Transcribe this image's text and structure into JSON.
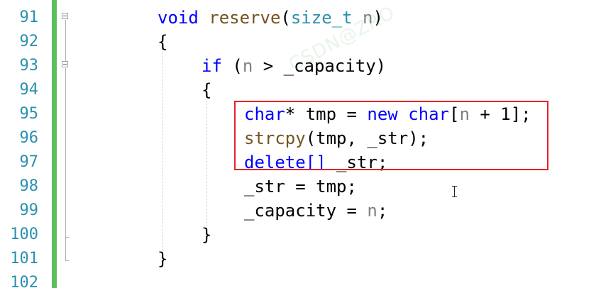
{
  "editor": {
    "lines": [
      {
        "num": "91",
        "tokens": [
          [
            "fn",
            "void "
          ],
          [
            "fn2",
            "reserve"
          ],
          [
            "pl",
            "("
          ],
          [
            "ty",
            "size_t"
          ],
          [
            "pl",
            " "
          ],
          [
            "pm",
            "n"
          ],
          [
            "pl",
            ")"
          ]
        ]
      },
      {
        "num": "92",
        "tokens": [
          [
            "pl",
            "{"
          ]
        ]
      },
      {
        "num": "93",
        "tokens": [
          [
            "kw",
            "if"
          ],
          [
            "pl",
            " ("
          ],
          [
            "pm",
            "n"
          ],
          [
            "pl",
            " > _capacity)"
          ]
        ]
      },
      {
        "num": "94",
        "tokens": [
          [
            "pl",
            "{"
          ]
        ]
      },
      {
        "num": "95",
        "tokens": [
          [
            "kw",
            "char"
          ],
          [
            "pl",
            "* tmp = "
          ],
          [
            "kw",
            "new"
          ],
          [
            "pl",
            " "
          ],
          [
            "kw",
            "char"
          ],
          [
            "pl",
            "["
          ],
          [
            "pm",
            "n"
          ],
          [
            "pl",
            " + 1];"
          ]
        ]
      },
      {
        "num": "96",
        "tokens": [
          [
            "fn2",
            "strcpy"
          ],
          [
            "pl",
            "(tmp, _str);"
          ]
        ]
      },
      {
        "num": "97",
        "tokens": [
          [
            "kw",
            "delete[]"
          ],
          [
            "pl",
            " _str;"
          ]
        ]
      },
      {
        "num": "98",
        "tokens": [
          [
            "pl",
            "_str = tmp;"
          ]
        ]
      },
      {
        "num": "99",
        "tokens": [
          [
            "pl",
            "_capacity = "
          ],
          [
            "pm",
            "n"
          ],
          [
            "pl",
            ";"
          ]
        ]
      },
      {
        "num": "100",
        "tokens": [
          [
            "pl",
            "}"
          ]
        ]
      },
      {
        "num": "101",
        "tokens": [
          [
            "pl",
            "}"
          ]
        ]
      },
      {
        "num": "102",
        "tokens": []
      }
    ],
    "watermark": "CSDN@ZRO",
    "highlight_color": "#e8202a",
    "change_bar_color": "#5bbf5b",
    "line_number_color": "#2b91af",
    "keyword_color": "#0000ff",
    "type_color": "#2b91af",
    "function_color": "#74531f",
    "param_color": "#808080"
  }
}
